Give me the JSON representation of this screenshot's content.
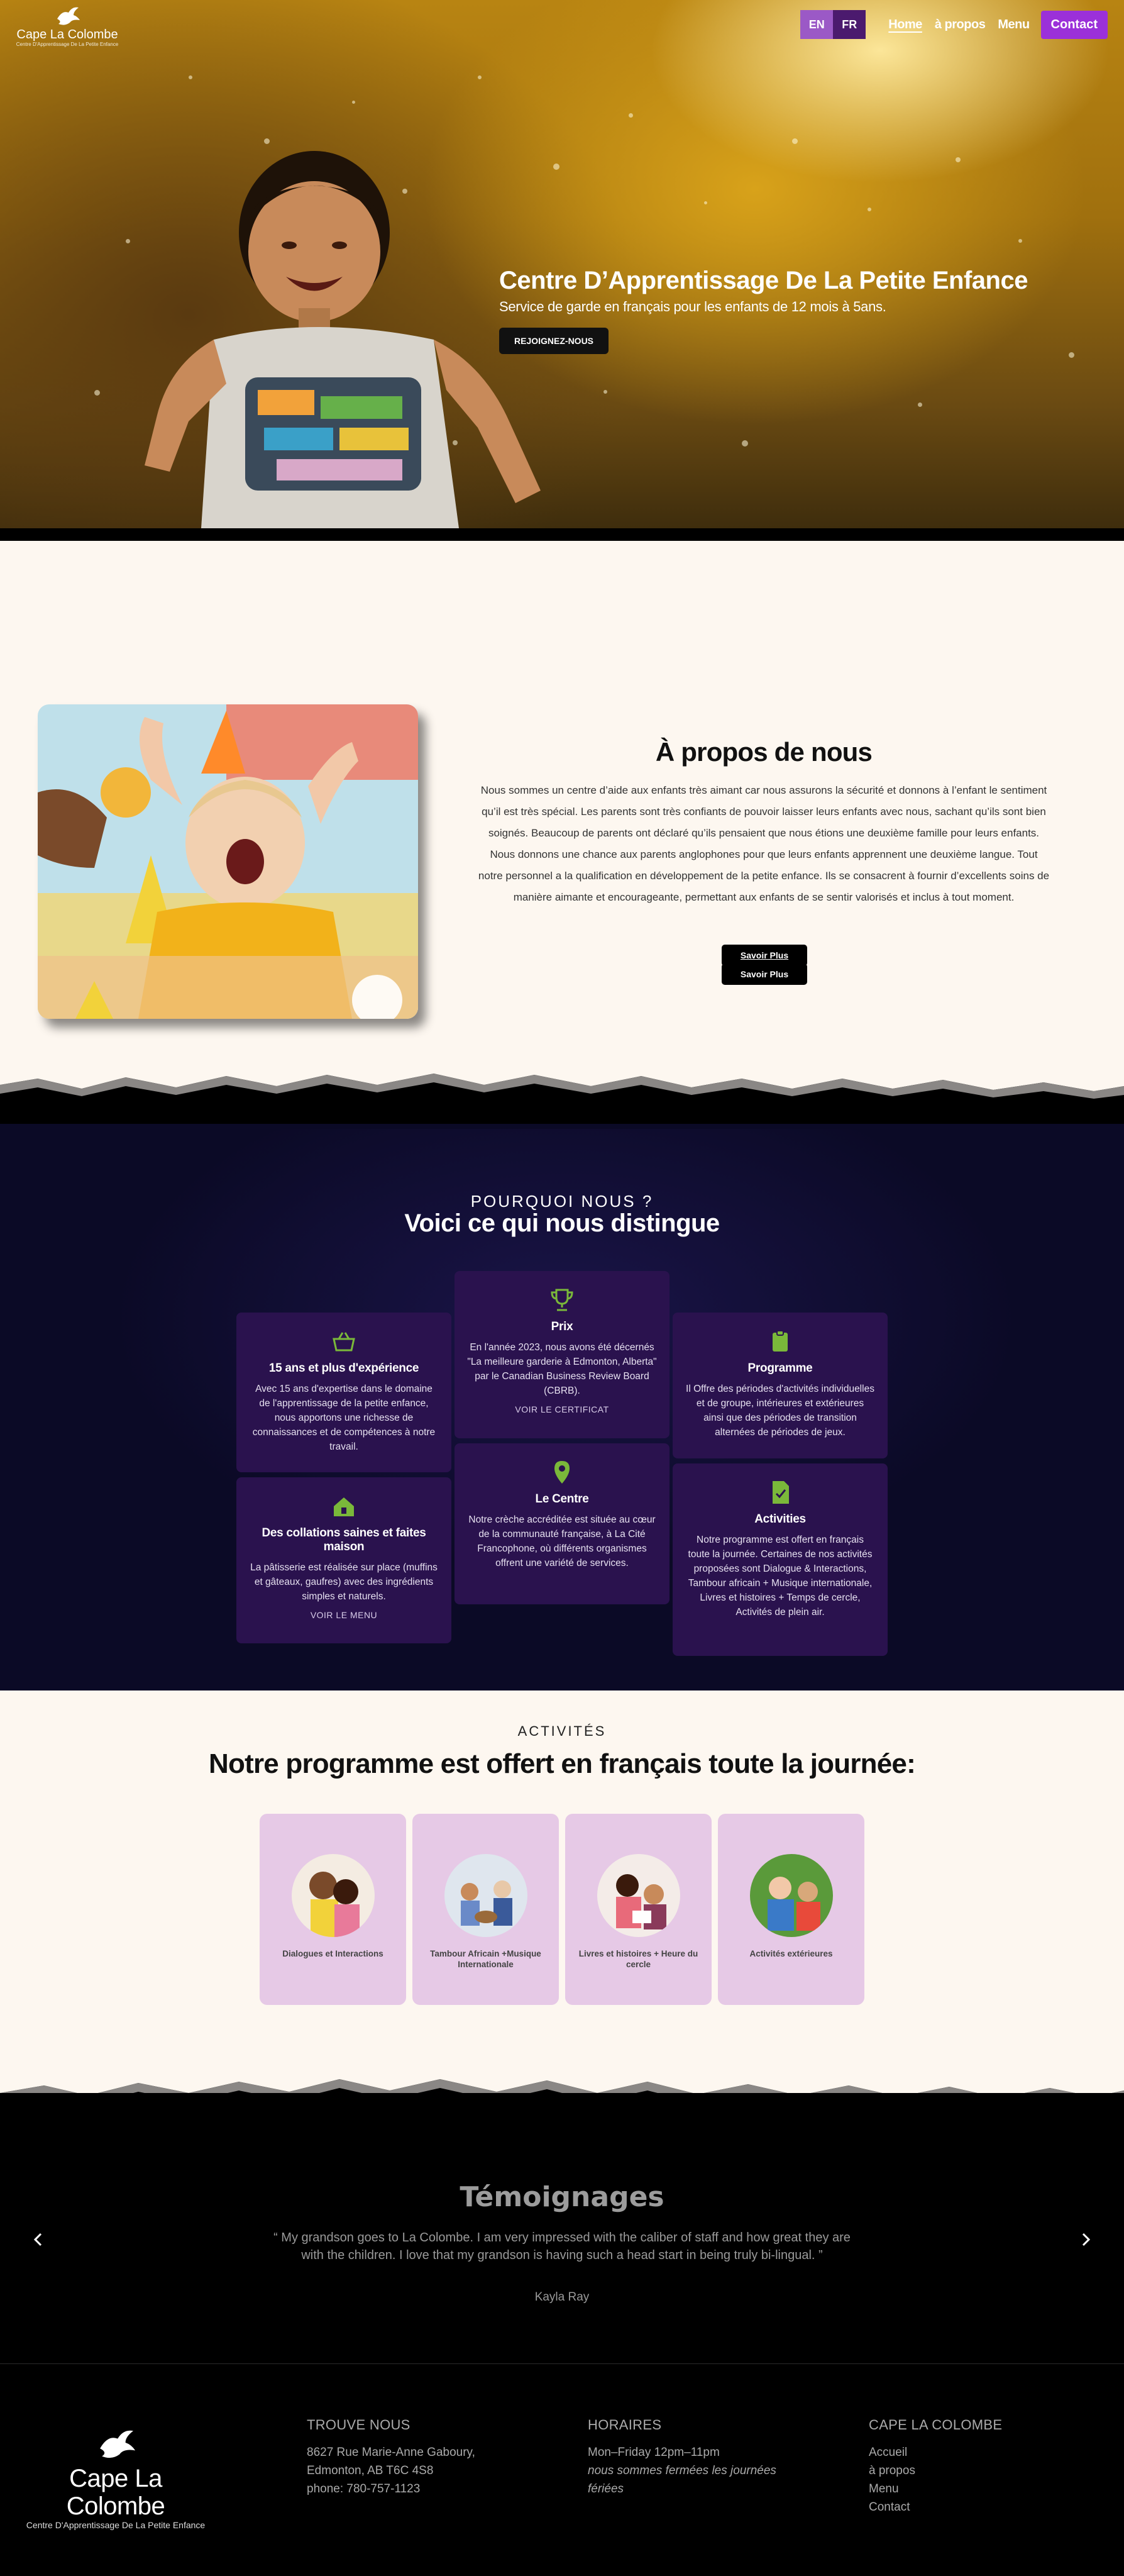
{
  "header": {
    "logo_name": "Cape La Colombe",
    "logo_sub": "Centre D'Apprentissage De La Petite Enfance",
    "lang_en": "EN",
    "lang_fr": "FR",
    "nav": [
      "Home",
      "à propos",
      "Menu"
    ],
    "contact": "Contact"
  },
  "hero": {
    "title": "Centre D’Apprentissage De La Petite Enfance",
    "subtitle": "Service de garde en français pour les enfants de 12 mois à 5ans.",
    "button": "REJOIGNEZ-NOUS"
  },
  "about": {
    "title": "À propos de nous",
    "body": "Nous sommes un centre d’aide aux enfants très aimant car nous assurons la sécurité et donnons à l’enfant le sentiment qu’il est très spécial. Les parents sont très confiants de pouvoir laisser leurs enfants avec nous, sachant qu’ils sont bien soignés. Beaucoup de parents ont déclaré qu’ils pensaient que nous étions une deuxième famille pour leurs enfants. Nous donnons une chance aux parents anglophones pour que leurs enfants apprennent une deuxième langue. Tout notre personnel a la qualification en développement de la petite enfance. Ils se consacrent à fournir d’excellents soins de manière aimante et encourageante, permettant aux enfants de se sentir valorisés et inclus à tout moment.",
    "button_1": "Savoir Plus",
    "button_2": "Savoir Plus"
  },
  "why": {
    "kicker": "POURQUOI NOUS ?",
    "title": "Voici ce qui nous distingue",
    "cards": [
      {
        "title": "15 ans et plus d'expérience",
        "text": "Avec 15 ans d'expertise dans le domaine de l'apprentissage de la petite enfance, nous apportons une richesse de connaissances et de compétences à notre travail.",
        "link": ""
      },
      {
        "title": "Prix",
        "text": "En l'année 2023, nous avons été décernés \"La meilleure garderie à Edmonton, Alberta\" par le Canadian Business Review Board (CBRB).",
        "link": "VOIR LE CERTIFICAT"
      },
      {
        "title": "Programme",
        "text": "Il Offre des périodes d'activités individuelles et de groupe, intérieures et extérieures ainsi que des périodes de transition alternées de périodes de jeux.",
        "link": ""
      },
      {
        "title": "Des collations saines et faites maison",
        "text": "La pâtisserie est réalisée sur place (muffins et gâteaux, gaufres) avec des ingrédients simples et naturels.",
        "link": "VOIR LE MENU"
      },
      {
        "title": "Le Centre",
        "text": "Notre crèche accréditée est située au cœur de la communauté française, à La Cité Francophone, où différents organismes offrent une variété de services.",
        "link": ""
      },
      {
        "title": "Activities",
        "text": "Notre programme est offert en français toute la journée. Certaines de nos activités proposées sont Dialogue & Interactions, Tambour africain + Musique internationale, Livres et histoires + Temps de cercle, Activités de plein air.",
        "link": ""
      }
    ]
  },
  "activities": {
    "kicker": "ACTIVITÉS",
    "title": "Notre programme est offert en français toute la journée:",
    "items": [
      "Dialogues et Interactions",
      "Tambour Africain +Musique Internationale",
      "Livres et histoires + Heure du cercle",
      "Activités extérieures"
    ]
  },
  "testimonials": {
    "title": "Témoignages",
    "quote": "“ My grandson goes to La Colombe. I am very impressed with the caliber of staff and how great they are with the children. I love that my grandson is having such a head start in being truly bi-lingual. ”",
    "name": "Kayla Ray"
  },
  "footer": {
    "logo_name": "Cape La Colombe",
    "logo_sub": "Centre D'Apprentissage De La Petite Enfance",
    "address_title": "TROUVE NOUS",
    "address": [
      "8627 Rue Marie-Anne Gaboury,",
      "Edmonton, AB T6C 4S8",
      "phone:  780-757-1123"
    ],
    "hours_title": "HORAIRES",
    "hours": [
      "Mon–Friday 12pm–11pm",
      "nous sommes fermées les journées",
      "fériées"
    ],
    "links_title": "CAPE LA COLOMBE",
    "links": [
      "Accueil",
      "à propos",
      "Menu",
      "Contact"
    ]
  },
  "colors": {
    "accent": "#9b30d9",
    "card": "#2a124e",
    "cream": "#fdf7f0",
    "icon_green": "#7ab83a"
  }
}
